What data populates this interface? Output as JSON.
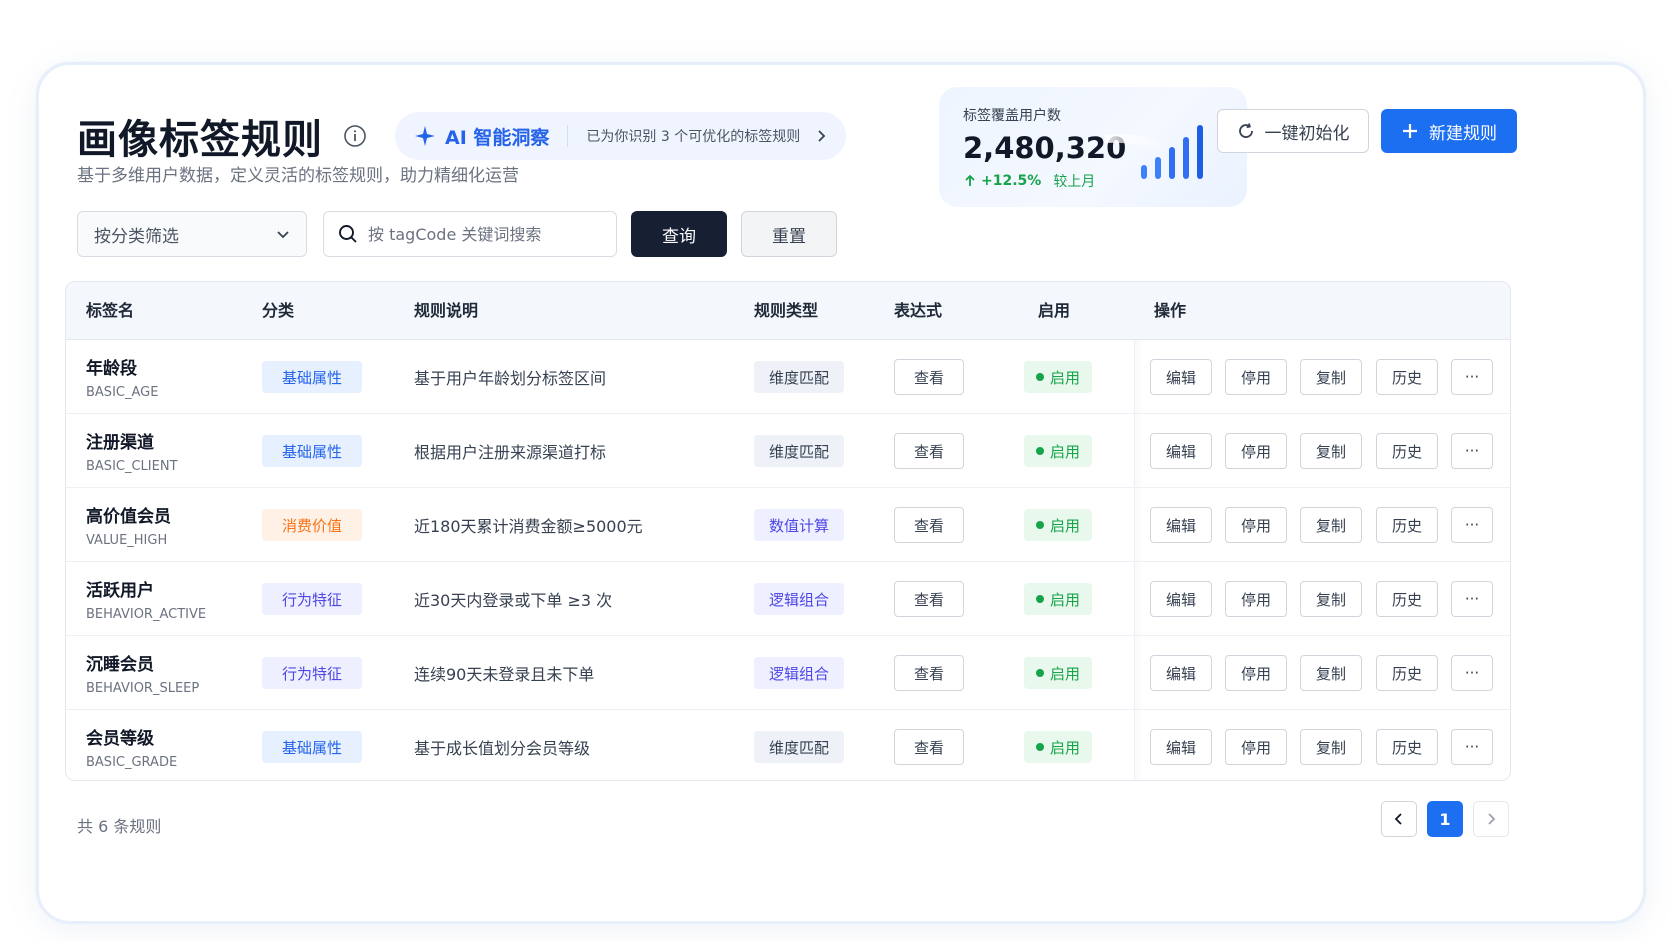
{
  "header": {
    "title": "画像标签规则",
    "subtitle": "基于多维用户数据，定义灵活的标签规则，助力精细化运营",
    "ai_label": "AI 智能洞察",
    "ai_hint": "已为你识别 3 个可优化的标签规则"
  },
  "stat": {
    "label": "标签覆盖用户数",
    "value": "2,480,320",
    "delta": "+12.5%",
    "compare": "较上月"
  },
  "actions": {
    "reinit_label": "一键初始化",
    "new_label": "新建规则"
  },
  "filters": {
    "category_label": "按分类筛选",
    "search_placeholder": "按 tagCode 关键词搜索",
    "query_label": "查询",
    "reset_label": "重置"
  },
  "table": {
    "columns": [
      "标签名",
      "分类",
      "规则说明",
      "规则类型",
      "表达式",
      "启用",
      "操作"
    ],
    "rows": [
      {
        "name": "年龄段",
        "code": "BASIC_AGE",
        "category": "基础属性",
        "desc": "基于用户年龄划分标签区间",
        "rtype": "维度匹配",
        "view": "查看",
        "status": "启用"
      },
      {
        "name": "注册渠道",
        "code": "BASIC_CLIENT",
        "category": "基础属性",
        "desc": "根据用户注册来源渠道打标",
        "rtype": "维度匹配",
        "view": "查看",
        "status": "启用"
      },
      {
        "name": "高价值会员",
        "code": "VALUE_HIGH",
        "category": "消费价值",
        "desc": "近180天累计消费金额≥5000元",
        "rtype": "数值计算",
        "view": "查看",
        "status": "启用"
      },
      {
        "name": "活跃用户",
        "code": "BEHAVIOR_ACTIVE",
        "category": "行为特征",
        "desc": "近30天内登录或下单 ≥3 次",
        "rtype": "逻辑组合",
        "view": "查看",
        "status": "启用"
      },
      {
        "name": "沉睡会员",
        "code": "BEHAVIOR_SLEEP",
        "category": "行为特征",
        "desc": "连续90天未登录且未下单",
        "rtype": "逻辑组合",
        "view": "查看",
        "status": "启用"
      },
      {
        "name": "会员等级",
        "code": "BASIC_GRADE",
        "category": "基础属性",
        "desc": "基于成长值划分会员等级",
        "rtype": "维度匹配",
        "view": "查看",
        "status": "启用"
      }
    ],
    "ops": {
      "edit": "编辑",
      "disable": "停用",
      "copy": "复制",
      "history": "历史",
      "more": "···"
    }
  },
  "footer": {
    "total": "共 6 条规则",
    "current_page": "1"
  },
  "colors": {
    "primary": "#1d6ff2",
    "dark_button": "#172033",
    "success": "#16a34a",
    "basic_chip": "#2563eb",
    "consume_chip": "#f97316",
    "behavior_chip": "#4f46e5"
  }
}
